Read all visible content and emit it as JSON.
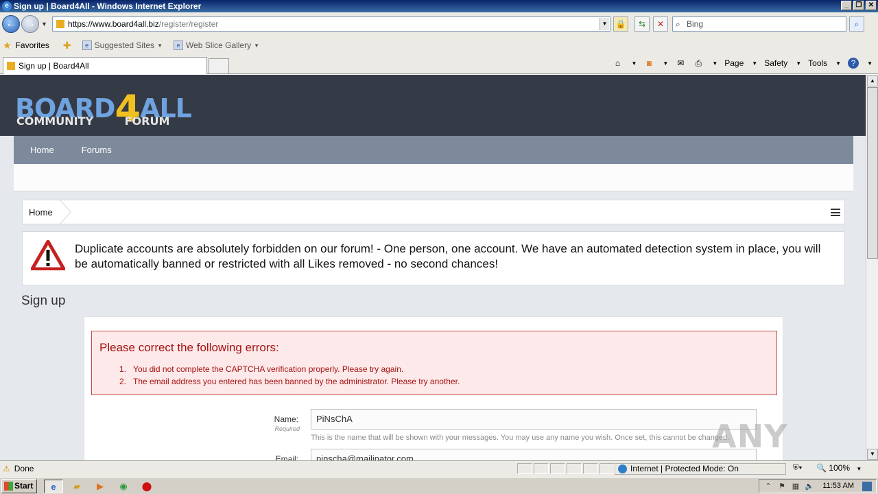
{
  "window": {
    "title": "Sign up | Board4All - Windows Internet Explorer"
  },
  "address_bar": {
    "url_scheme_host": "https://www.board4all.biz",
    "url_path": "/register/register"
  },
  "search": {
    "placeholder": "Bing"
  },
  "favorites_bar": {
    "favorites_label": "Favorites",
    "items": [
      {
        "label": "Suggested Sites",
        "icon": "ie-page-icon"
      },
      {
        "label": "Web Slice Gallery",
        "icon": "ie-page-icon"
      }
    ]
  },
  "tab": {
    "label": "Sign up | Board4All"
  },
  "command_bar": {
    "page_label": "Page",
    "safety_label": "Safety",
    "tools_label": "Tools"
  },
  "site": {
    "logo_word_1": "BOARD",
    "logo_four": "4",
    "logo_word_2": "ALL",
    "logo_sub_1": "COMMUNITY",
    "logo_sub_2": "FORUM",
    "nav": [
      {
        "label": "Home"
      },
      {
        "label": "Forums"
      }
    ],
    "breadcrumb": [
      "Home"
    ],
    "notice": "Duplicate accounts are absolutely forbidden on our forum! - One person, one account. We have an automated detection system in place, you will be automatically banned or restricted with all Likes removed - no second chances!",
    "page_title": "Sign up"
  },
  "errors": {
    "title": "Please correct the following errors:",
    "items": [
      {
        "n": "1.",
        "text": "You did not complete the CAPTCHA verification properly. Please try again."
      },
      {
        "n": "2.",
        "text": "The email address you entered has been banned by the administrator. Please try another."
      }
    ]
  },
  "form": {
    "name_label": "Name:",
    "name_required": "Required",
    "name_value": "PiNsChA",
    "name_help": "This is the name that will be shown with your messages. You may use any name you wish. Once set, this cannot be changed.",
    "email_label": "Email:",
    "email_value": "pinscha@mailinator.com"
  },
  "watermark": "ANY RUN",
  "status_bar": {
    "status": "Done",
    "zone": "Internet | Protected Mode: On",
    "zoom": "100%"
  },
  "taskbar": {
    "start_label": "Start",
    "clock": "11:53 AM"
  },
  "colors": {
    "header_bg": "#353b46",
    "nav_bg": "#7d8a9c",
    "error_text": "#a61212",
    "error_bg": "#fde9e9",
    "logo_blue": "#6fa3e0",
    "logo_yellow": "#f0c020"
  }
}
